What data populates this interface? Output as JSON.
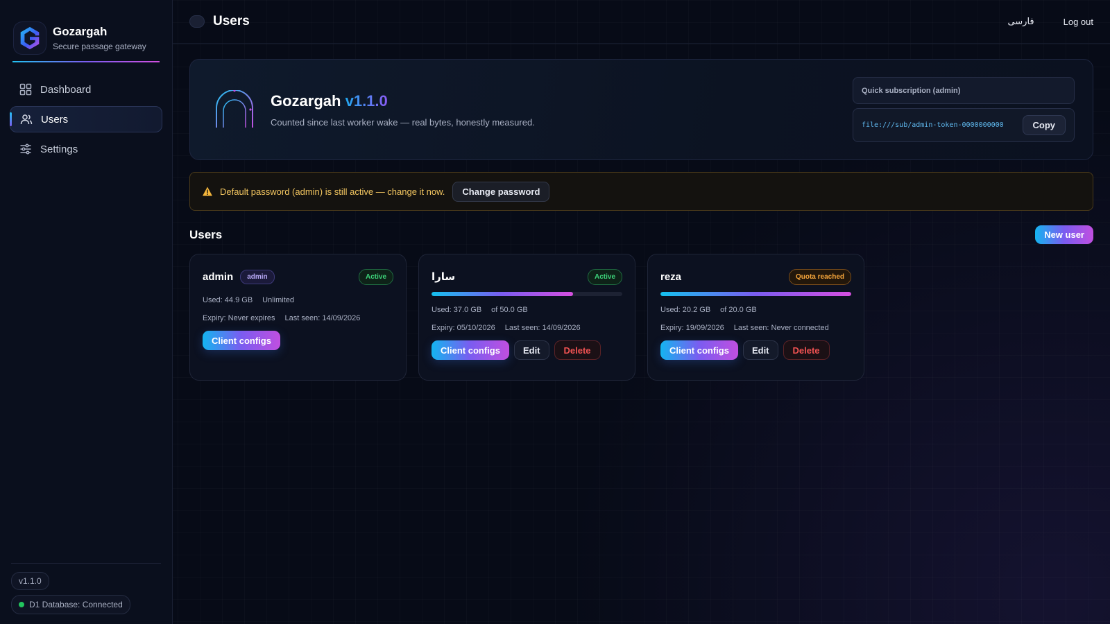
{
  "brand": {
    "name": "Gozargah",
    "tagline": "Secure passage gateway"
  },
  "sidebar": {
    "items": [
      {
        "label": "Dashboard",
        "icon": "grid-icon",
        "active": false
      },
      {
        "label": "Users",
        "icon": "users-icon",
        "active": true
      },
      {
        "label": "Settings",
        "icon": "sliders-icon",
        "active": false
      }
    ],
    "version": "v1.1.0",
    "db_status": "D1 Database: Connected"
  },
  "topbar": {
    "title": "Users",
    "language": "فارسی",
    "logout": "Log out"
  },
  "hero": {
    "title": "Gozargah",
    "version": "v1.1.0",
    "subtitle": "Counted since last worker wake — real bytes, honestly measured.",
    "sub_label": "Quick subscription (admin)",
    "sub_url": "file:///sub/admin-token-0000000000",
    "copy_label": "Copy"
  },
  "warning": {
    "text": "Default password (admin) is still active — change it now.",
    "button": "Change password"
  },
  "users_section": {
    "title": "Users",
    "new_user": "New user",
    "cards": [
      {
        "name": "admin",
        "badge": "admin",
        "status": "Active",
        "used": "Used: 44.9 GB",
        "quota": "Unlimited",
        "expiry": "Expiry: Never expires",
        "last_seen": "Last seen: 14/09/2026",
        "client_configs": "Client configs"
      },
      {
        "name": "سارا",
        "status": "Active",
        "progress": 0.74,
        "used": "Used: 37.0 GB",
        "quota": "of 50.0 GB",
        "expiry": "Expiry: 05/10/2026",
        "last_seen": "Last seen: 14/09/2026",
        "client_configs": "Client configs",
        "edit": "Edit",
        "delete": "Delete"
      },
      {
        "name": "reza",
        "status": "Quota reached",
        "progress": 1.0,
        "used": "Used: 20.2 GB",
        "quota": "of 20.0 GB",
        "expiry": "Expiry: 19/09/2026",
        "last_seen": "Last seen: Never connected",
        "client_configs": "Client configs",
        "edit": "Edit",
        "delete": "Delete"
      }
    ]
  },
  "colors": {
    "accent_cyan": "#14b4f0",
    "accent_violet": "#7b5cf0",
    "accent_pink": "#c04fe0",
    "active_green": "#3dd37a",
    "quota_orange": "#f5a53b",
    "delete_red": "#f05252"
  }
}
